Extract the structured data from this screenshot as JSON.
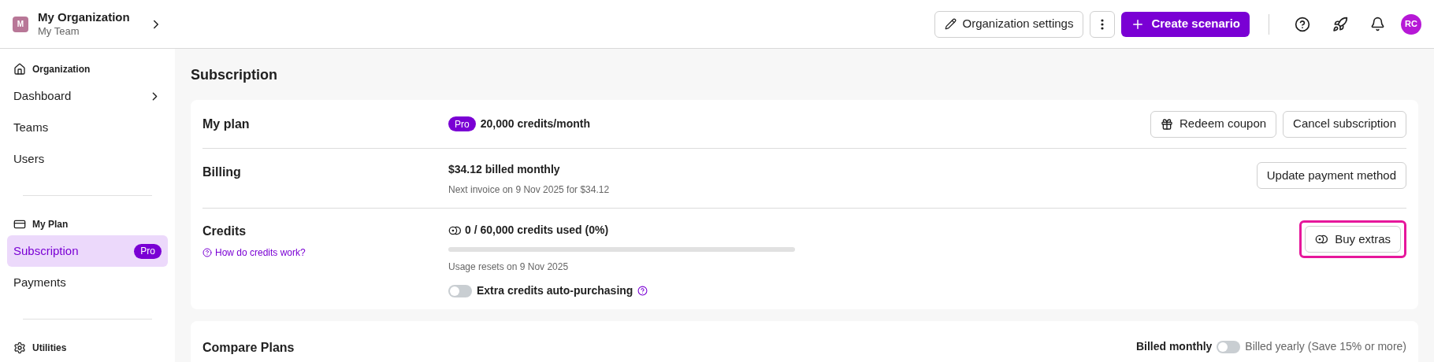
{
  "header": {
    "org_initial": "M",
    "org_name": "My Organization",
    "team_name": "My Team",
    "settings_button": "Organization settings",
    "create_button": "Create scenario",
    "avatar_initials": "RC"
  },
  "sidebar": {
    "sections": [
      {
        "kind": "home",
        "title": "Organization",
        "items": [
          {
            "label": "Dashboard",
            "selected": false,
            "has_chevron": true
          },
          {
            "label": "Teams",
            "selected": false,
            "has_chevron": false
          },
          {
            "label": "Users",
            "selected": false,
            "has_chevron": false
          }
        ]
      },
      {
        "kind": "card",
        "title": "My Plan",
        "items": [
          {
            "label": "Subscription",
            "selected": true,
            "has_chevron": false,
            "badge": "Pro"
          },
          {
            "label": "Payments",
            "selected": false,
            "has_chevron": false
          }
        ]
      },
      {
        "kind": "gear",
        "title": "Utilities"
      }
    ]
  },
  "page_title": "Subscription",
  "plan": {
    "label": "My plan",
    "badge": "Pro",
    "credits": "20,000 credits/month",
    "buttons": [
      {
        "kind": "gift",
        "label": "Redeem coupon"
      },
      {
        "kind": "plain",
        "label": "Cancel subscription"
      }
    ]
  },
  "billing": {
    "label": "Billing",
    "amount": "$34.12 billed monthly",
    "next_invoice": "Next invoice on 9 Nov 2025 for $34.12",
    "button": "Update payment method"
  },
  "credits": {
    "label": "Credits",
    "help_link": "How do credits work?",
    "usage": "0 / 60,000 credits used (0%)",
    "level": 0,
    "reset": "Usage resets on 9 Nov 2025",
    "auto_purchase": {
      "label": "Extra credits auto-purchasing",
      "on": false
    },
    "button": {
      "label": "Buy extras",
      "highlighted": true
    }
  },
  "compare": {
    "title": "Compare Plans",
    "monthly_label": "Billed monthly",
    "yearly_label": "Billed yearly (Save 15% or more)",
    "yearly": false
  }
}
